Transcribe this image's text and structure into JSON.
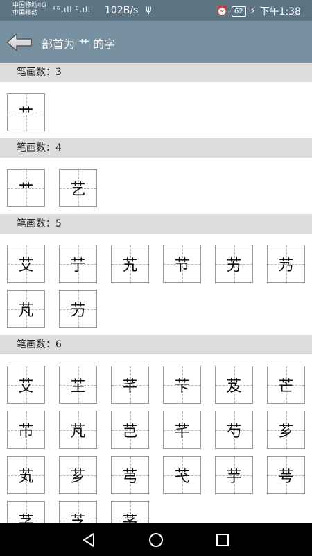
{
  "status_bar": {
    "carrier_line1": "中国移动4G",
    "carrier_line2": "中国移动",
    "signal_text": "⁴ᴳ.ıll ᴱ.ıll",
    "net_speed": "102B/s",
    "usb_symbol": "ψ",
    "alarm_symbol": "⏰",
    "battery": "62",
    "charging_symbol": "⚡",
    "time": "下午1:38"
  },
  "app_bar": {
    "title": "部首为 艹 的字",
    "back_icon": "back-arrow-icon"
  },
  "sections": [
    {
      "header": "笔画数：3",
      "chars": [
        "艹"
      ]
    },
    {
      "header": "笔画数：4",
      "chars": [
        "艹",
        "艺"
      ]
    },
    {
      "header": "笔画数：5",
      "chars": [
        "艾",
        "艼",
        "艽",
        "节",
        "艻",
        "艿",
        "芃",
        "芀"
      ]
    },
    {
      "header": "笔画数：6",
      "chars": [
        "艾",
        "芏",
        "芊",
        "芐",
        "芨",
        "芒",
        "芇",
        "芃",
        "芑",
        "芊",
        "芍",
        "芗",
        "芄",
        "芗",
        "芎",
        "芅",
        "芋",
        "芌",
        "芓",
        "芝",
        "芧"
      ]
    }
  ],
  "nav_bar": {
    "back": "nav-back-icon",
    "home": "nav-home-icon",
    "recents": "nav-recents-icon"
  }
}
